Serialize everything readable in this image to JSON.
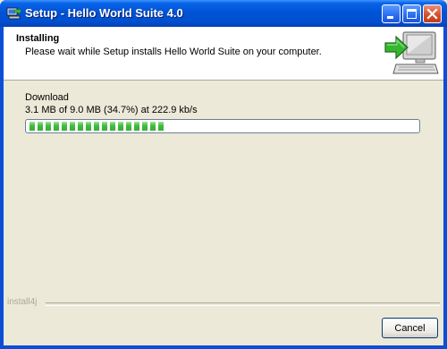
{
  "window": {
    "title": "Setup - Hello World Suite 4.0",
    "app_icon": "installer-icon"
  },
  "titlebar_buttons": {
    "minimize": "minimize-icon",
    "maximize": "maximize-icon",
    "close": "close-icon"
  },
  "header": {
    "title": "Installing",
    "subtitle": "Please wait while Setup installs Hello World Suite on your computer.",
    "graphic": "computer-install-icon"
  },
  "download": {
    "label": "Download",
    "status": "3.1 MB of 9.0 MB (34.7%) at 222.9 kb/s",
    "progress_percent": 34.7
  },
  "footer": {
    "brand": "install4j",
    "cancel_label": "Cancel"
  },
  "colors": {
    "titlebar": "#0054e3",
    "progress": "#3fbc3a",
    "dialog_bg": "#ece9d8"
  }
}
